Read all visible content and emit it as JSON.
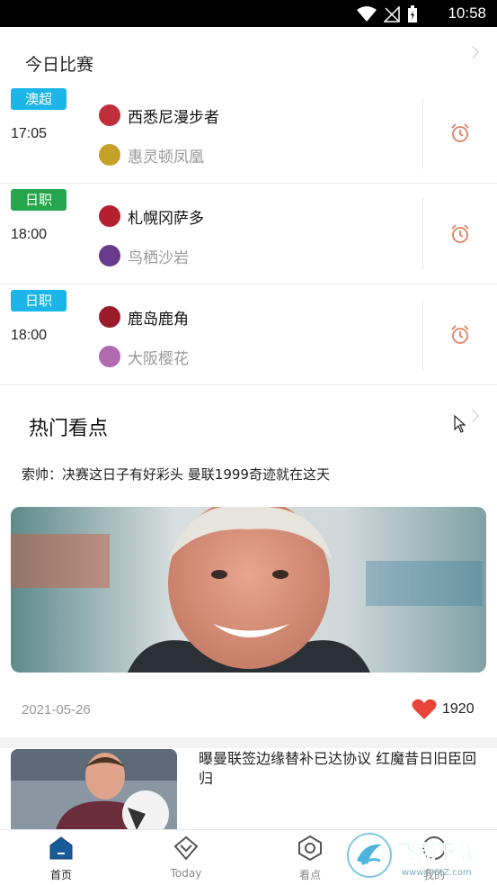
{
  "status_bar": {
    "time": "10:58"
  },
  "today": {
    "title": "今日比赛",
    "matches": [
      {
        "league": "澳超",
        "league_color": "#1cb5e8",
        "time": "17:05",
        "home": "西悉尼漫步者",
        "away": "惠灵顿凤凰",
        "home_logo_color": "#c0303a",
        "away_logo_color": "#c6a12a"
      },
      {
        "league": "日职",
        "league_color": "#26a64a",
        "time": "18:00",
        "home": "札幌冈萨多",
        "away": "鸟栖沙岩",
        "home_logo_color": "#b5202e",
        "away_logo_color": "#6a3a8e"
      },
      {
        "league": "日职",
        "league_color": "#1cb5e8",
        "time": "18:00",
        "home": "鹿岛鹿角",
        "away": "大阪樱花",
        "home_logo_color": "#9a1c2a",
        "away_logo_color": "#b06ab0"
      }
    ]
  },
  "hot": {
    "title": "热门看点",
    "featured": {
      "headline": "索帅：决赛这日子有好彩头 曼联1999奇迹就在这天",
      "date": "2021-05-26",
      "likes": "1920"
    },
    "second": {
      "title": "曝曼联签边缘替补已达协议 红魔昔日旧臣回归"
    }
  },
  "nav": [
    {
      "label": "首页",
      "icon": "home-icon",
      "active": true
    },
    {
      "label": "Today",
      "icon": "today-icon",
      "active": false
    },
    {
      "label": "看点",
      "icon": "hexagon-icon",
      "active": false
    },
    {
      "label": "我的",
      "icon": "profile-icon",
      "active": false
    }
  ],
  "watermark": {
    "brand": "飞翔下载",
    "url": "www.FXXZ.com"
  },
  "colors": {
    "accent_red": "#e8443a",
    "alarm": "#e08060",
    "tag_blue": "#1cb5e8",
    "tag_green": "#26a64a"
  }
}
